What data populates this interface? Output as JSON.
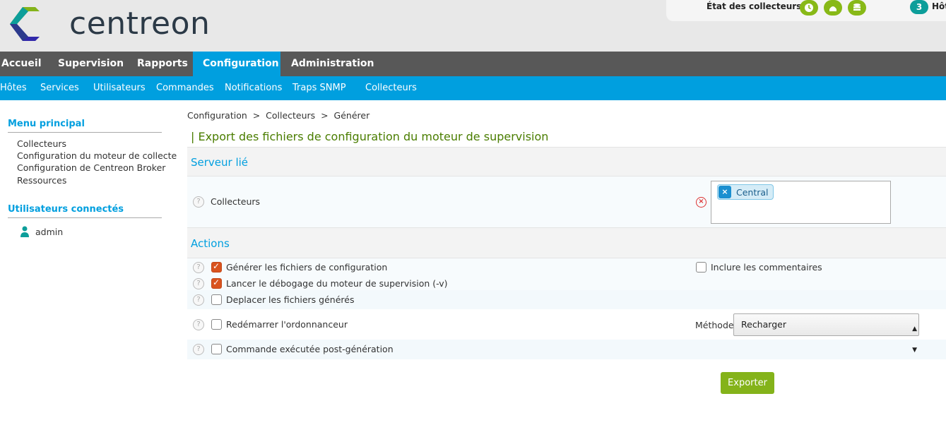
{
  "header": {
    "logo_text": "centreon",
    "pollers_label": "État des collecteurs",
    "hosts_count": "3",
    "hosts_label": "Hôt"
  },
  "nav": {
    "items": [
      "Accueil",
      "Supervision",
      "Rapports",
      "Configuration",
      "Administration"
    ],
    "active": "Configuration"
  },
  "subnav": {
    "items": [
      "Hôtes",
      "Services",
      "Utilisateurs",
      "Commandes",
      "Notifications",
      "Traps SNMP",
      "Collecteurs"
    ]
  },
  "sidebar": {
    "main_menu_title": "Menu principal",
    "main_menu_items": [
      "Collecteurs",
      "Configuration du moteur de collecte",
      "Configuration de Centreon Broker",
      "Ressources"
    ],
    "users_title": "Utilisateurs connectés",
    "users": [
      "admin"
    ]
  },
  "breadcrumb": "Configuration  >  Collecteurs  >  Générer",
  "page_title": "| Export des fichiers de configuration du moteur de supervision",
  "sections": {
    "linked_server": "Serveur lié",
    "actions": "Actions"
  },
  "pollers_field": {
    "label": "Collecteurs",
    "selected": [
      "Central"
    ]
  },
  "actions": {
    "generate": {
      "label": "Générer les fichiers de configuration",
      "checked": true
    },
    "include_comments": {
      "label": "Inclure les commentaires",
      "checked": false
    },
    "debug": {
      "label": "Lancer le débogage du moteur de supervision (-v)",
      "checked": true
    },
    "move": {
      "label": "Deplacer les fichiers générés",
      "checked": false
    },
    "restart": {
      "label": "Redémarrer l'ordonnanceur",
      "checked": false
    },
    "method_label": "Méthode",
    "method_value": "Recharger",
    "post_cmd": {
      "label": "Commande exécutée post-génération",
      "checked": false
    }
  },
  "export_button": "Exporter",
  "colors": {
    "accent_blue": "#009fdf",
    "nav_dark": "#585858",
    "green_button": "#84b31a",
    "checkbox_orange": "#d9531e"
  }
}
